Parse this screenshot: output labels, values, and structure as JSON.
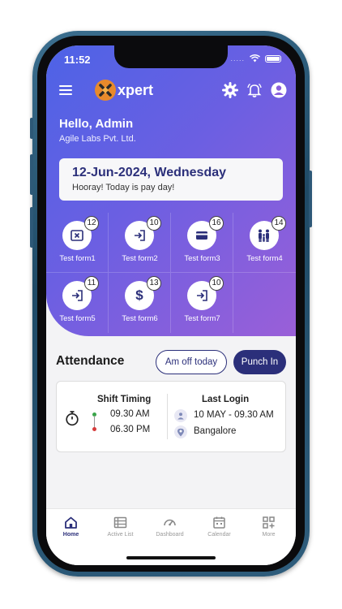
{
  "status_bar": {
    "time": "11:52",
    "dots": "....."
  },
  "app": {
    "brand": "xpert"
  },
  "greeting": {
    "hello": "Hello, Admin",
    "company": "Agile Labs Pvt. Ltd."
  },
  "date_card": {
    "date": "12-Jun-2024, Wednesday",
    "message": "Hooray! Today is pay day!"
  },
  "forms": [
    {
      "label": "Test form1",
      "count": "12",
      "icon": "close-box-icon"
    },
    {
      "label": "Test form2",
      "count": "10",
      "icon": "login-arrow-icon"
    },
    {
      "label": "Test form3",
      "count": "16",
      "icon": "credit-card-icon"
    },
    {
      "label": "Test form4",
      "count": "14",
      "icon": "family-icon"
    },
    {
      "label": "Test form5",
      "count": "11",
      "icon": "login-arrow-icon"
    },
    {
      "label": "Test form6",
      "count": "13",
      "icon": "dollar-icon"
    },
    {
      "label": "Test form7",
      "count": "10",
      "icon": "login-arrow-icon"
    }
  ],
  "attendance": {
    "title": "Attendance",
    "off_button": "Am off today",
    "punch_button": "Punch In",
    "shift_title": "Shift Timing",
    "shift_start": "09.30 AM",
    "shift_end": "06.30 PM",
    "login_title": "Last Login",
    "login_time": "10 MAY - 09.30 AM",
    "login_location": "Bangalore"
  },
  "nav": [
    {
      "label": "Home",
      "icon": "home-icon",
      "active": true
    },
    {
      "label": "Active List",
      "icon": "list-icon",
      "active": false
    },
    {
      "label": "Dashboard",
      "icon": "gauge-icon",
      "active": false
    },
    {
      "label": "Calendar",
      "icon": "calendar-icon",
      "active": false
    },
    {
      "label": "More",
      "icon": "grid-plus-icon",
      "active": false
    }
  ],
  "colors": {
    "gradient_start": "#4d63e6",
    "gradient_end": "#9a5fd8",
    "primary": "#2b2f7a",
    "logo_orange": "#e88a2c",
    "dot_green": "#3aa64a",
    "dot_red": "#d63a3a"
  }
}
